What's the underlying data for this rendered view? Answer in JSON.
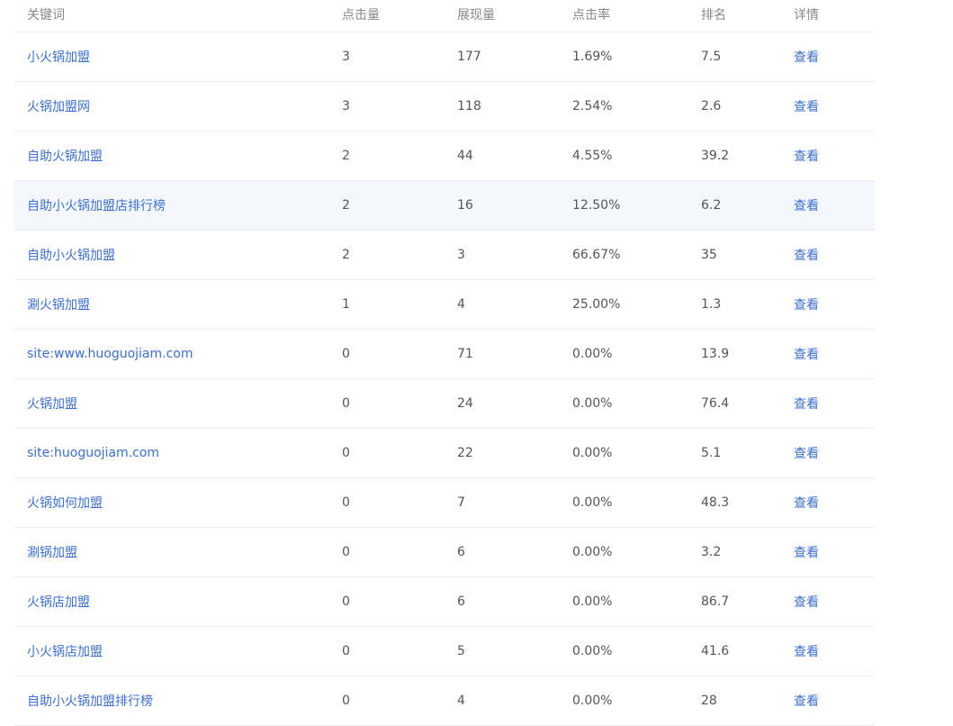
{
  "table": {
    "headers": {
      "keyword": "关键词",
      "clicks": "点击量",
      "impressions": "展现量",
      "ctr": "点击率",
      "rank": "排名",
      "detail": "详情"
    },
    "highlight_row_index": 3,
    "rows": [
      {
        "keyword": "小火锅加盟",
        "clicks": "3",
        "impressions": "177",
        "ctr": "1.69%",
        "rank": "7.5",
        "detail": "查看"
      },
      {
        "keyword": "火锅加盟网",
        "clicks": "3",
        "impressions": "118",
        "ctr": "2.54%",
        "rank": "2.6",
        "detail": "查看"
      },
      {
        "keyword": "自助火锅加盟",
        "clicks": "2",
        "impressions": "44",
        "ctr": "4.55%",
        "rank": "39.2",
        "detail": "查看"
      },
      {
        "keyword": "自助小火锅加盟店排行榜",
        "clicks": "2",
        "impressions": "16",
        "ctr": "12.50%",
        "rank": "6.2",
        "detail": "查看"
      },
      {
        "keyword": "自助小火锅加盟",
        "clicks": "2",
        "impressions": "3",
        "ctr": "66.67%",
        "rank": "35",
        "detail": "查看"
      },
      {
        "keyword": "涮火锅加盟",
        "clicks": "1",
        "impressions": "4",
        "ctr": "25.00%",
        "rank": "1.3",
        "detail": "查看"
      },
      {
        "keyword": "site:www.huoguojiam.com",
        "clicks": "0",
        "impressions": "71",
        "ctr": "0.00%",
        "rank": "13.9",
        "detail": "查看"
      },
      {
        "keyword": "火锅加盟",
        "clicks": "0",
        "impressions": "24",
        "ctr": "0.00%",
        "rank": "76.4",
        "detail": "查看"
      },
      {
        "keyword": "site:huoguojiam.com",
        "clicks": "0",
        "impressions": "22",
        "ctr": "0.00%",
        "rank": "5.1",
        "detail": "查看"
      },
      {
        "keyword": "火锅如何加盟",
        "clicks": "0",
        "impressions": "7",
        "ctr": "0.00%",
        "rank": "48.3",
        "detail": "查看"
      },
      {
        "keyword": "涮锅加盟",
        "clicks": "0",
        "impressions": "6",
        "ctr": "0.00%",
        "rank": "3.2",
        "detail": "查看"
      },
      {
        "keyword": "火锅店加盟",
        "clicks": "0",
        "impressions": "6",
        "ctr": "0.00%",
        "rank": "86.7",
        "detail": "查看"
      },
      {
        "keyword": "小火锅店加盟",
        "clicks": "0",
        "impressions": "5",
        "ctr": "0.00%",
        "rank": "41.6",
        "detail": "查看"
      },
      {
        "keyword": "自助小火锅加盟排行榜",
        "clicks": "0",
        "impressions": "4",
        "ctr": "0.00%",
        "rank": "28",
        "detail": "查看"
      }
    ]
  },
  "colors": {
    "link": "#3b6fd4",
    "text": "#555555",
    "header_text": "#888888",
    "divider": "#ececec",
    "row_highlight": "#f4f8fe"
  }
}
